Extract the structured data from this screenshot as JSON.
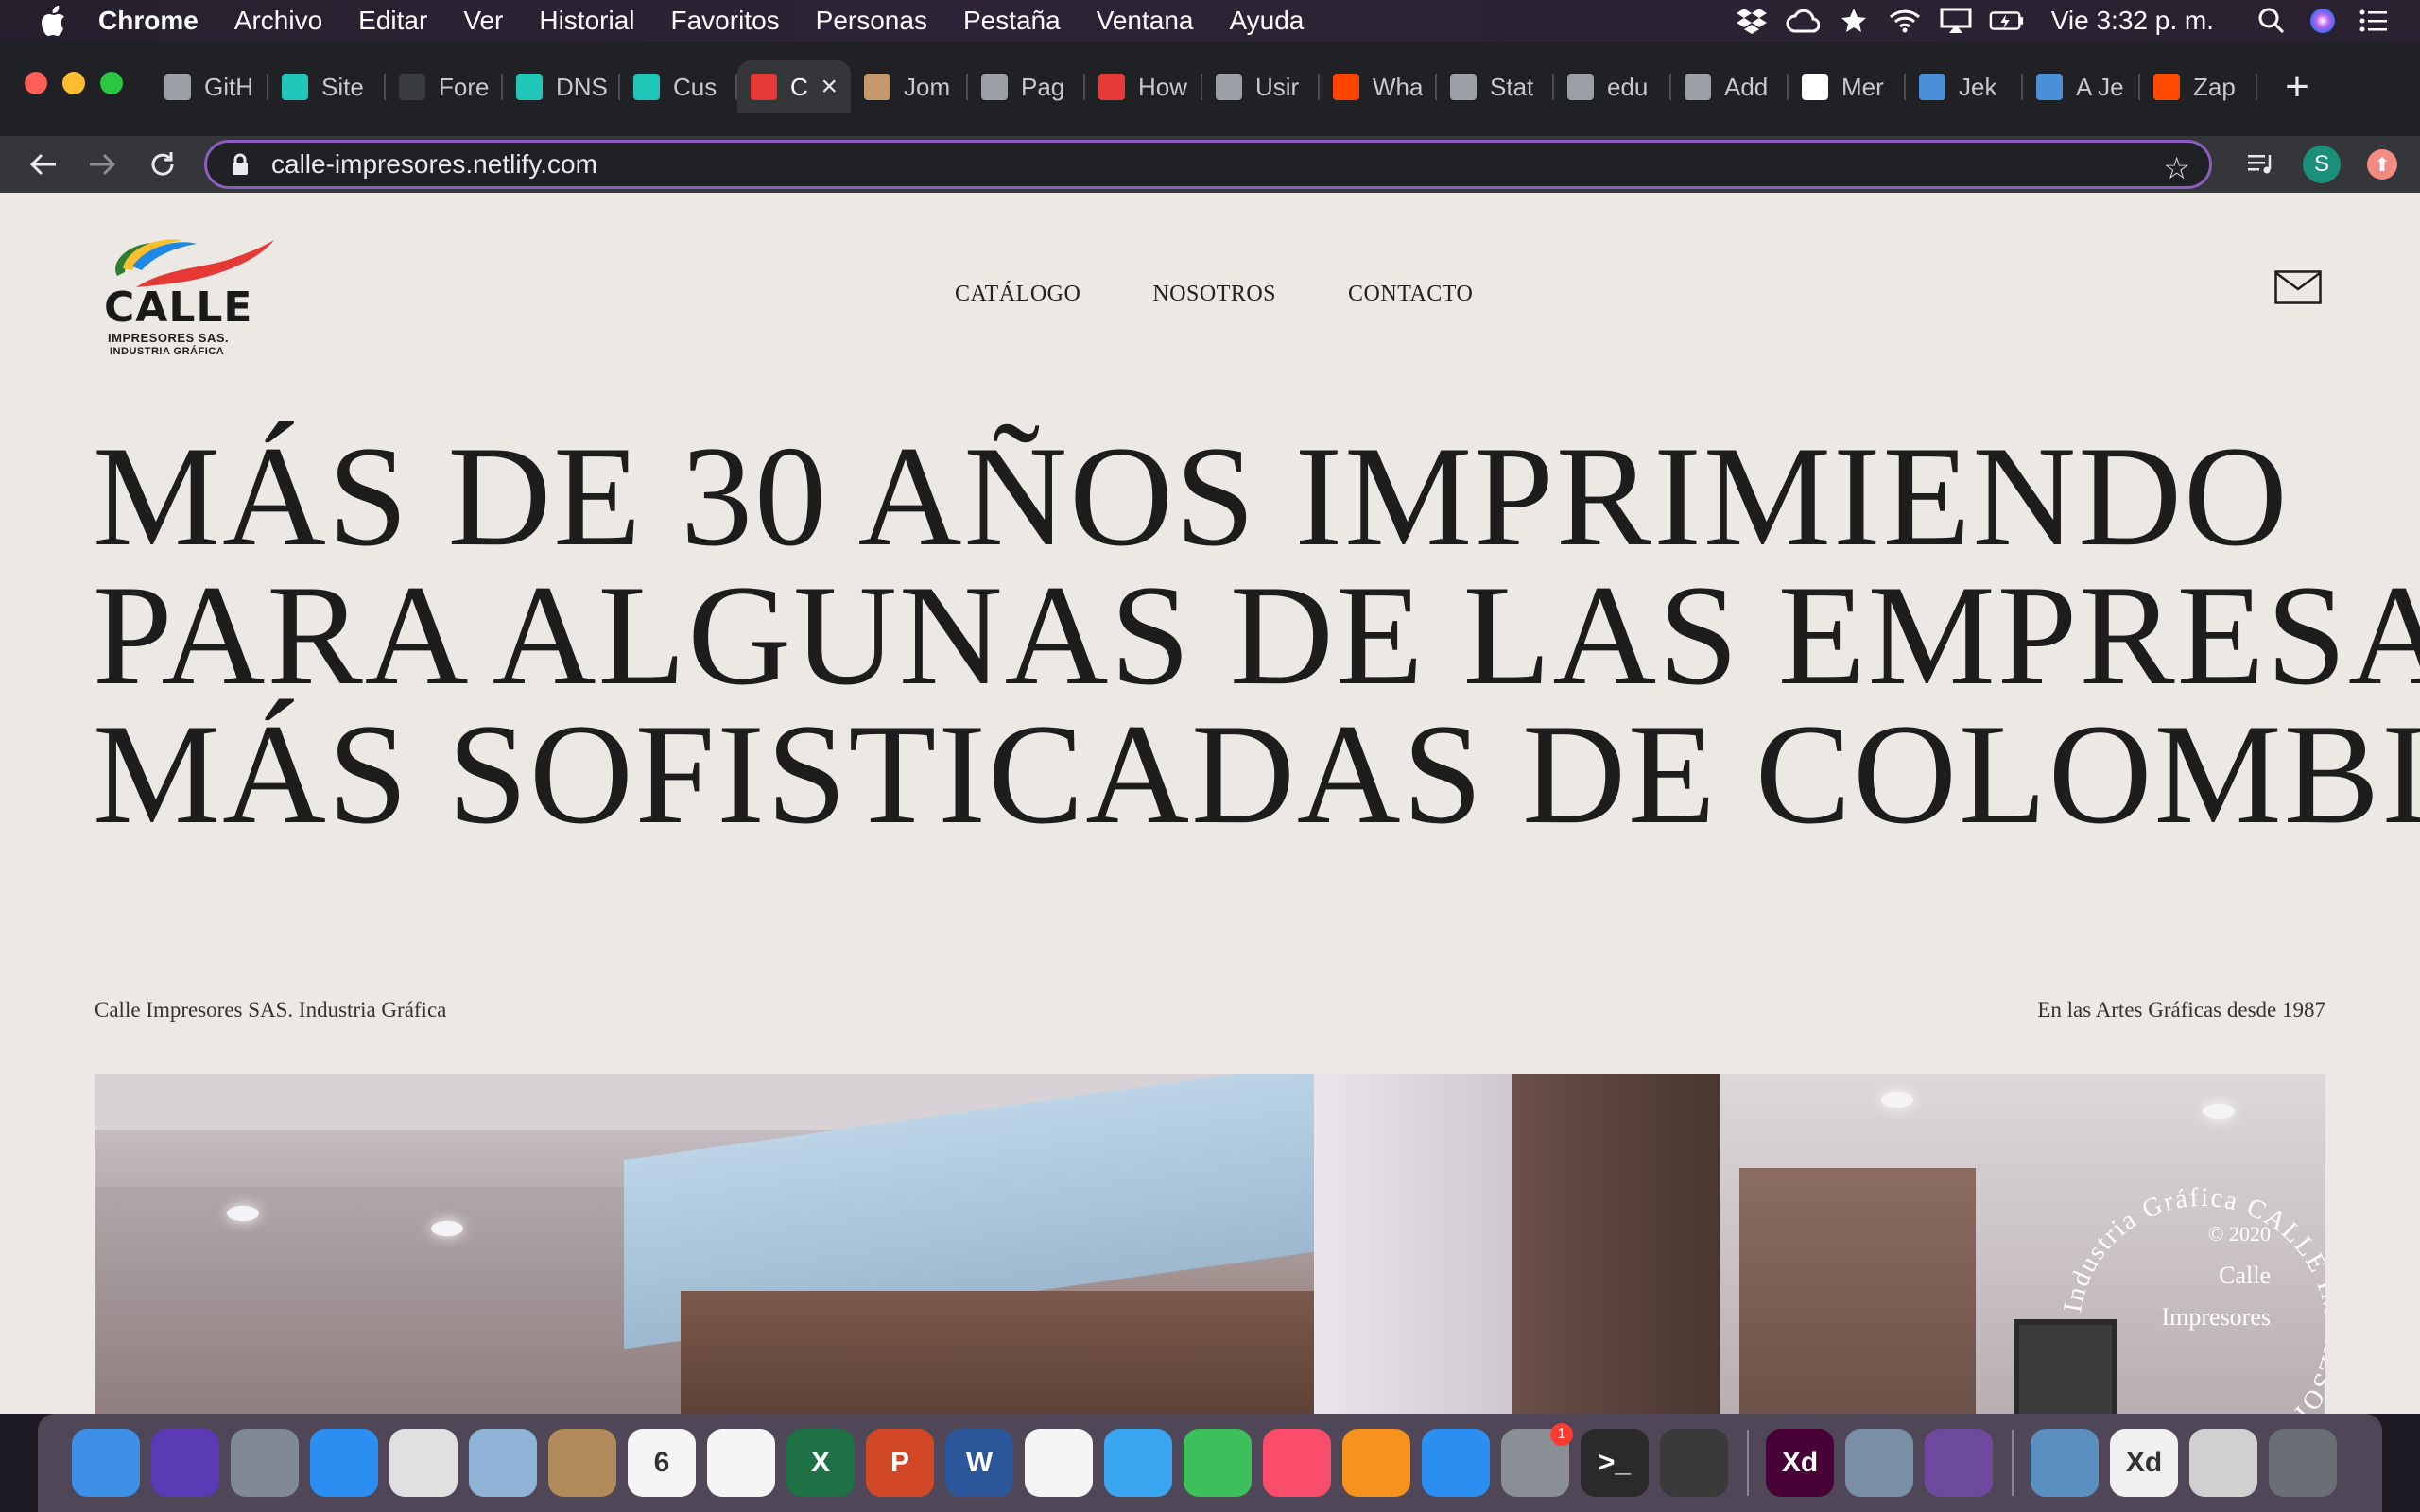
{
  "menubar": {
    "app_name": "Chrome",
    "items": [
      "Archivo",
      "Editar",
      "Ver",
      "Historial",
      "Favoritos",
      "Personas",
      "Pestaña",
      "Ventana",
      "Ayuda"
    ],
    "clock": "Vie 3:32 p. m.",
    "status_icons": [
      "dropbox-icon",
      "creative-cloud-icon",
      "sync-icon",
      "wifi-icon",
      "airplay-icon",
      "battery-icon",
      "spotlight-icon",
      "siri-icon",
      "control-center-icon"
    ]
  },
  "browser": {
    "tabs": [
      {
        "title": "GitH",
        "icon": "github-icon",
        "color": "#9aa0a6"
      },
      {
        "title": "Site",
        "icon": "netlify-icon",
        "color": "#20c6b7"
      },
      {
        "title": "Fore",
        "icon": "forestry-icon",
        "color": "#3a3d40"
      },
      {
        "title": "DNS",
        "icon": "netlify-icon",
        "color": "#20c6b7"
      },
      {
        "title": "Cus",
        "icon": "netlify-icon",
        "color": "#20c6b7"
      },
      {
        "title": "C",
        "icon": "calle-favicon",
        "color": "#e53935"
      },
      {
        "title": "Jom",
        "icon": "avatar-favicon",
        "color": "#c49a6c"
      },
      {
        "title": "Pag",
        "icon": "globe-icon",
        "color": "#9aa0a6"
      },
      {
        "title": "How",
        "icon": "d-favicon",
        "color": "#e53935"
      },
      {
        "title": "Usir",
        "icon": "globe-icon",
        "color": "#9aa0a6"
      },
      {
        "title": "Wha",
        "icon": "reddit-icon",
        "color": "#ff4500"
      },
      {
        "title": "Stat",
        "icon": "chart-icon",
        "color": "#9aa0a6"
      },
      {
        "title": "edu",
        "icon": "github-icon",
        "color": "#9aa0a6"
      },
      {
        "title": "Add",
        "icon": "owl-icon",
        "color": "#9aa0a6"
      },
      {
        "title": "Mer",
        "icon": "m-favicon",
        "color": "#ffffff"
      },
      {
        "title": "Jek",
        "icon": "jekyll-icon",
        "color": "#4a90d9"
      },
      {
        "title": "A Je",
        "icon": "jekyll-icon",
        "color": "#4a90d9"
      },
      {
        "title": "Zap",
        "icon": "zapier-icon",
        "color": "#ff4a00"
      }
    ],
    "active_tab_index": 5,
    "url": "calle-impresores.netlify.com",
    "profile_initial": "S"
  },
  "site": {
    "logo_text": "CALLE",
    "logo_sub1": "IMPRESORES SAS.",
    "logo_sub2": "INDUSTRIA GRÁFICA",
    "nav": [
      "CATÁLOGO",
      "NOSOTROS",
      "CONTACTO"
    ],
    "hero_lines": [
      "MÁS DE 30 AÑOS IMPRIMIENDO",
      "PARA ALGUNAS DE LAS EMPRESAS",
      "MÁS SOFISTICADAS DE COLOMBIA"
    ],
    "meta_left": "Calle Impresores SAS. Industria Gráfica",
    "meta_right": "En las Artes Gráficas desde 1987",
    "badge_text": "Industria Gráfica CALLE IMPRESORES SAS",
    "copyright_year": "© 2020",
    "copyright_name1": "Calle",
    "copyright_name2": "Impresores"
  },
  "dock": {
    "apps": [
      {
        "name": "finder",
        "label": "",
        "color": "#3d8fe6"
      },
      {
        "name": "siri",
        "label": "",
        "color": "#5b3bb5"
      },
      {
        "name": "launchpad",
        "label": "",
        "color": "#7f8a96"
      },
      {
        "name": "safari",
        "label": "",
        "color": "#2a8ff0"
      },
      {
        "name": "chrome",
        "label": "",
        "color": "#e0e0e0"
      },
      {
        "name": "preview",
        "label": "",
        "color": "#8fb4d8"
      },
      {
        "name": "notefile",
        "label": "",
        "color": "#b08a5a"
      },
      {
        "name": "calendar",
        "label": "6",
        "color": "#f5f5f5"
      },
      {
        "name": "reminders",
        "label": "",
        "color": "#f5f5f5"
      },
      {
        "name": "excel",
        "label": "X",
        "color": "#1e7145"
      },
      {
        "name": "powerpoint",
        "label": "P",
        "color": "#d24726"
      },
      {
        "name": "word",
        "label": "W",
        "color": "#2b579a"
      },
      {
        "name": "photos",
        "label": "",
        "color": "#f5f5f5"
      },
      {
        "name": "messages",
        "label": "",
        "color": "#3aa5f0"
      },
      {
        "name": "facetime",
        "label": "",
        "color": "#3cbf5a"
      },
      {
        "name": "music",
        "label": "",
        "color": "#fa4d6b"
      },
      {
        "name": "books",
        "label": "",
        "color": "#f7921e"
      },
      {
        "name": "app-store",
        "label": "",
        "color": "#2a8ff0"
      },
      {
        "name": "system-preferences",
        "label": "",
        "color": "#8a8f96",
        "badge": "1"
      },
      {
        "name": "terminal",
        "label": ">_",
        "color": "#2a2a2a"
      },
      {
        "name": "sublime",
        "label": "",
        "color": "#3a3a3a"
      },
      {
        "name": "adobe-xd",
        "label": "Xd",
        "color": "#470137"
      },
      {
        "name": "image-capture",
        "label": "",
        "color": "#7a8fa6"
      },
      {
        "name": "github-desktop",
        "label": "",
        "color": "#6e4a9e"
      },
      {
        "name": "downloads",
        "label": "",
        "color": "#5a8fc0"
      },
      {
        "name": "xd-docs",
        "label": "Xd",
        "color": "#f0f0f0"
      },
      {
        "name": "documents",
        "label": "",
        "color": "#d0d0d0"
      },
      {
        "name": "trash",
        "label": "",
        "color": "#6a6f76"
      }
    ]
  }
}
